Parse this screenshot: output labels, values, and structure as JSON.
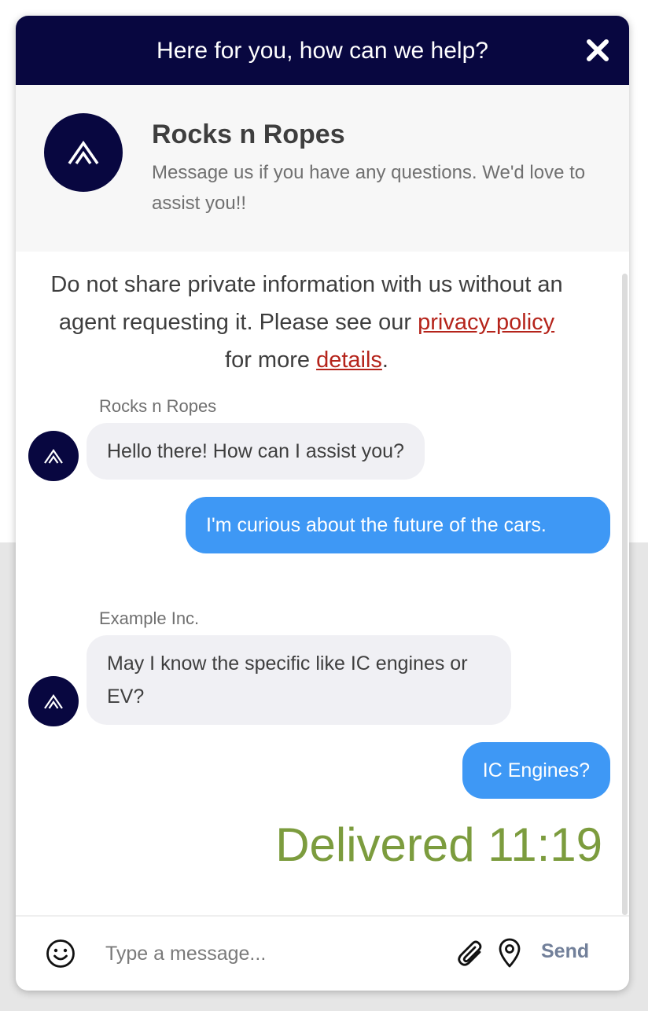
{
  "header": {
    "title": "Here for you, how can we help?",
    "close_icon": "close-icon"
  },
  "profile": {
    "name": "Rocks n Ropes",
    "description": "Message us if you have any questions. We'd love to assist you!!"
  },
  "notice": {
    "text_before": "Do not share private information with us without an agent requesting it. Please see our ",
    "privacy_link": "privacy policy",
    "text_middle": " for more ",
    "details_link": "details",
    "text_after": "."
  },
  "messages": [
    {
      "direction": "in",
      "sender": "Rocks n Ropes",
      "text": "Hello there! How can I assist you?"
    },
    {
      "direction": "out",
      "text": "I'm curious about the future of the cars."
    },
    {
      "direction": "in",
      "sender": "Example Inc.",
      "text": "May I know the specific like IC engines or EV?"
    },
    {
      "direction": "out",
      "text": "IC Engines?"
    }
  ],
  "status": {
    "delivered": "Delivered 11:19"
  },
  "composer": {
    "placeholder": "Type a message...",
    "send_label": "Send",
    "emoji_icon": "smiley-icon",
    "attach_icon": "paperclip-icon",
    "location_icon": "location-pin-icon"
  },
  "colors": {
    "header_bg": "#080740",
    "outgoing_bubble": "#3e98f5",
    "incoming_bubble": "#f0f0f4",
    "link": "#b5241b",
    "delivered": "#7c9c3e"
  }
}
